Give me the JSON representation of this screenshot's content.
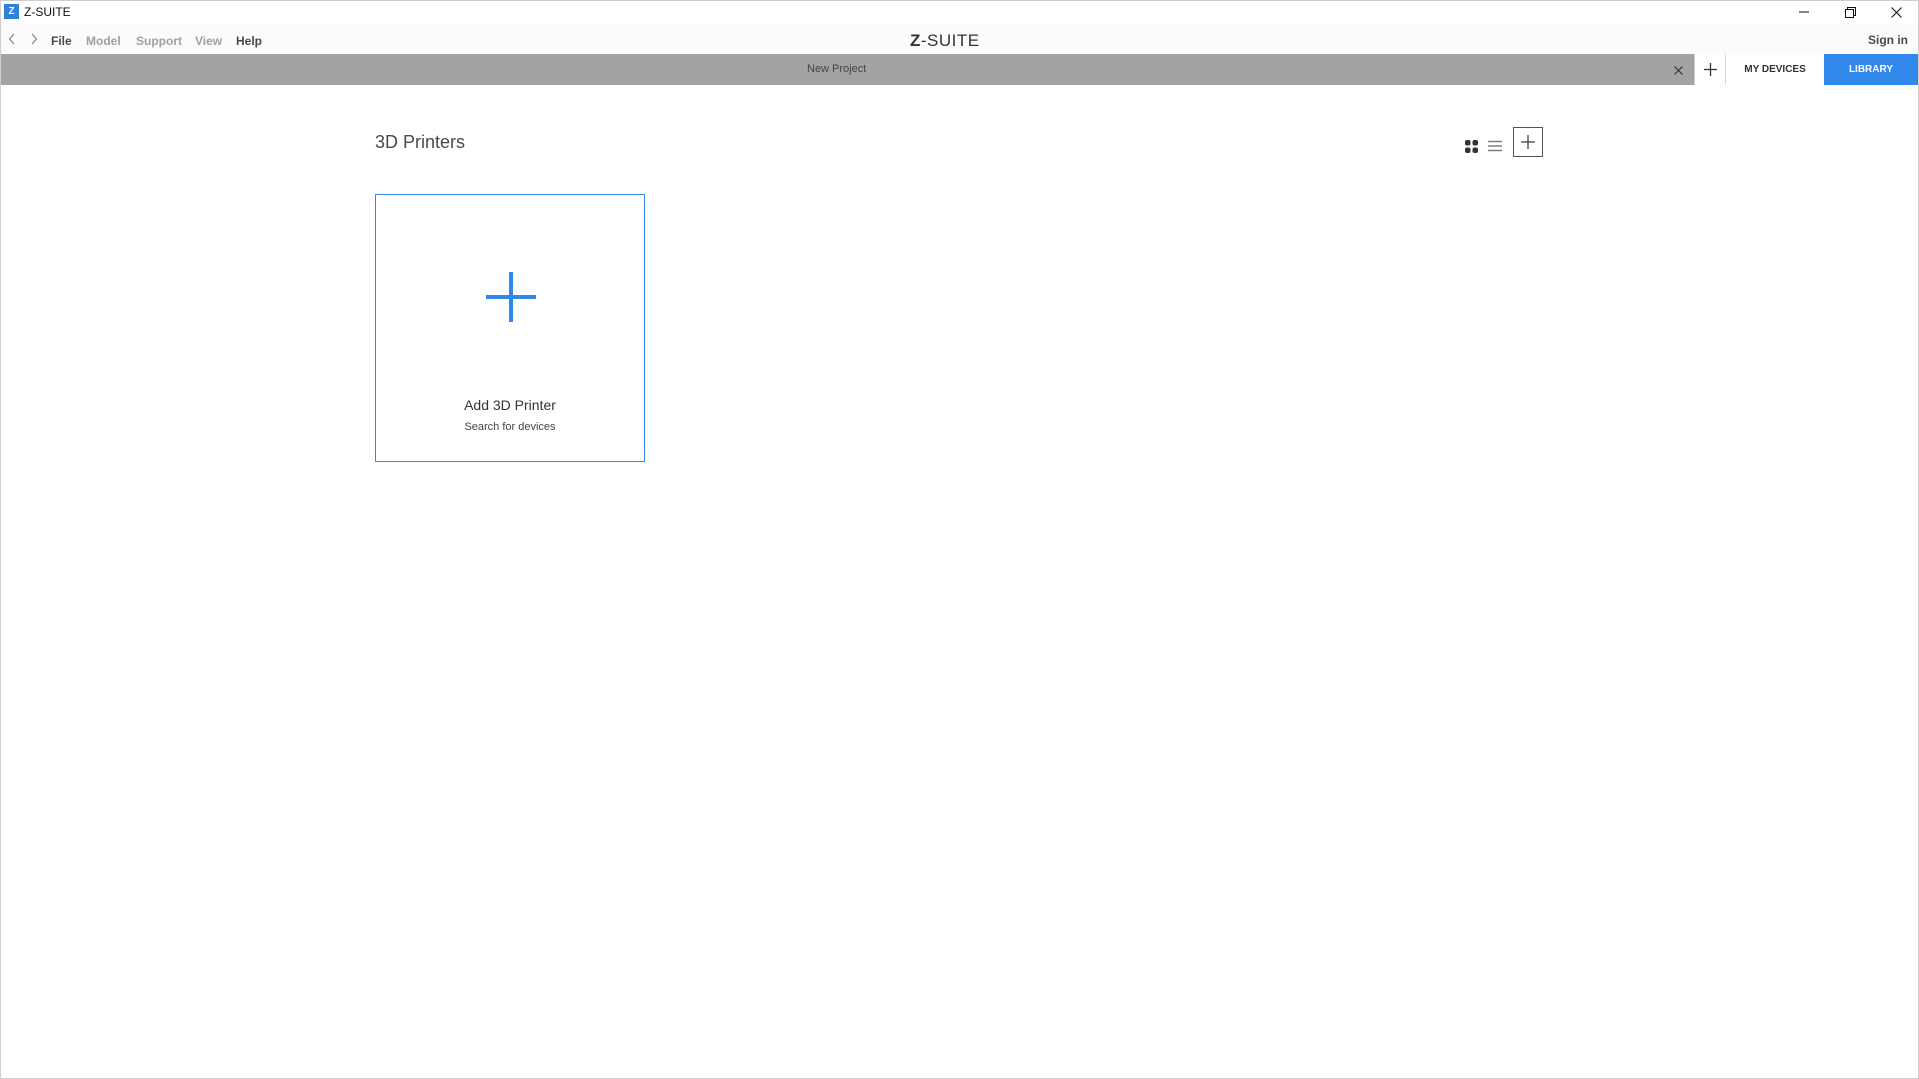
{
  "window": {
    "app_icon_letter": "Z",
    "title": "Z-SUITE"
  },
  "menubar": {
    "items": [
      {
        "label": "File",
        "enabled": true
      },
      {
        "label": "Model",
        "enabled": false
      },
      {
        "label": "Support",
        "enabled": false
      },
      {
        "label": "View",
        "enabled": false
      },
      {
        "label": "Help",
        "enabled": true
      }
    ],
    "brand_prefix": "Z",
    "brand_suffix": "-SUITE",
    "sign_in_label": "Sign in"
  },
  "tabbar": {
    "project_tab_label": "New Project",
    "devices_tab_label": "MY DEVICES",
    "library_tab_label": "LIBRARY",
    "active_tab": "LIBRARY"
  },
  "main": {
    "section_title": "3D Printers",
    "add_card": {
      "title": "Add 3D Printer",
      "subtitle": "Search for devices"
    }
  },
  "colors": {
    "accent": "#2f88ea",
    "tabbar_bg": "#a3a3a3",
    "text_dark": "#4a4a4a",
    "text_disabled": "#a0a0a0"
  },
  "icons": {
    "back": "chevron-left-icon",
    "forward": "chevron-right-icon",
    "minimize": "minimize-icon",
    "restore": "restore-icon",
    "close": "close-icon",
    "add_tab": "plus-icon",
    "grid_view": "grid-view-icon",
    "list_view": "list-view-icon",
    "add_device": "plus-icon",
    "card_plus": "plus-icon"
  }
}
